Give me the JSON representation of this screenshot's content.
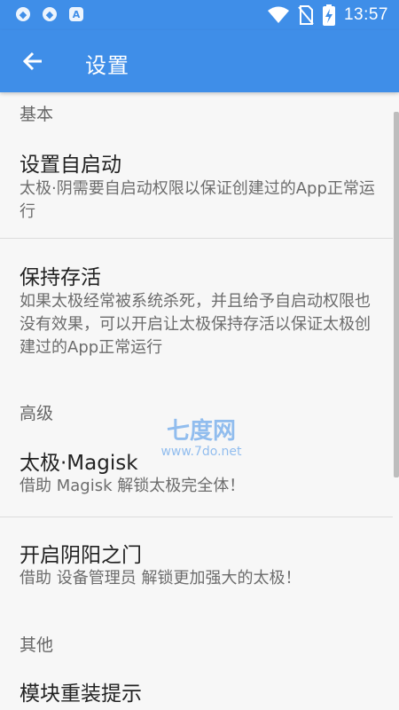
{
  "status_bar": {
    "left_icons": [
      "shield-icon",
      "shield-icon",
      "a-icon"
    ],
    "time": "13:57",
    "right_icons": [
      "wifi-icon",
      "no-sim-icon",
      "battery-charging-icon"
    ]
  },
  "app_bar": {
    "back_icon": "arrow-left-icon",
    "title": "设置"
  },
  "sections": [
    {
      "header": "基本",
      "items": [
        {
          "title": "设置自启动",
          "summary": "太极·阴需要自启动权限以保证创建过的App正常运行"
        },
        {
          "title": "保持存活",
          "summary": "如果太极经常被系统杀死，并且给予自启动权限也没有效果，可以开启让太极保持存活以保证太极创建过的App正常运行"
        }
      ]
    },
    {
      "header": "高级",
      "items": [
        {
          "title": "太极·Magisk",
          "summary": "借助 Magisk 解锁太极完全体！"
        },
        {
          "title": "开启阴阳之门",
          "summary": "借助 设备管理员 解锁更加强大的太极！"
        }
      ]
    },
    {
      "header": "其他",
      "items": [
        {
          "title": "模块重装提示",
          "summary": ""
        }
      ]
    }
  ],
  "watermark": {
    "logo": "七度网",
    "url": "www.7do.net"
  },
  "colors": {
    "primary": "#3f8ee8",
    "background": "#f7f7f7",
    "title_text": "#222222",
    "summary_text": "#6c6c6c",
    "section_text": "#666666",
    "divider": "#dcdcdc"
  }
}
